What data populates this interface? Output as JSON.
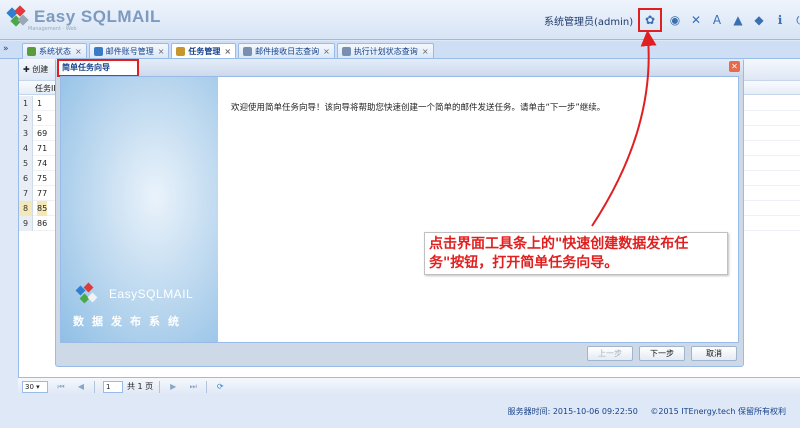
{
  "app": {
    "title": "Easy SQLMAIL",
    "subtitle": "Management · Web",
    "user": "系统管理员(admin)"
  },
  "toolbar": {
    "icons": [
      {
        "name": "quick-create-task-icon",
        "glyph": "✿",
        "highlighted": true
      },
      {
        "name": "globe-icon",
        "glyph": "◉",
        "highlighted": false
      },
      {
        "name": "tools-icon",
        "glyph": "✕",
        "highlighted": false
      },
      {
        "name": "font-icon",
        "glyph": "A",
        "highlighted": false
      },
      {
        "name": "chart-icon",
        "glyph": "▲",
        "highlighted": false
      },
      {
        "name": "box-icon",
        "glyph": "◆",
        "highlighted": false
      },
      {
        "name": "info-icon",
        "glyph": "ℹ",
        "highlighted": false
      },
      {
        "name": "power-icon",
        "glyph": "⏻",
        "highlighted": false
      }
    ]
  },
  "tabs": [
    {
      "label": "系统状态",
      "active": false,
      "color": "#5a9b3c"
    },
    {
      "label": "邮件账号管理",
      "active": false,
      "color": "#3a7bc8"
    },
    {
      "label": "任务管理",
      "active": true,
      "color": "#c8962e"
    },
    {
      "label": "邮件接收日志查询",
      "active": false,
      "color": "#7a8fb0"
    },
    {
      "label": "执行计划状态查询",
      "active": false,
      "color": "#7a8fb0"
    }
  ],
  "grid": {
    "create_label": "创建",
    "column_header": "任务ID",
    "rows": [
      {
        "n": "1",
        "v": "1",
        "selected": false
      },
      {
        "n": "2",
        "v": "5",
        "selected": false
      },
      {
        "n": "3",
        "v": "69",
        "selected": false
      },
      {
        "n": "4",
        "v": "71",
        "selected": false
      },
      {
        "n": "5",
        "v": "74",
        "selected": false
      },
      {
        "n": "6",
        "v": "75",
        "selected": false
      },
      {
        "n": "7",
        "v": "77",
        "selected": false
      },
      {
        "n": "8",
        "v": "85",
        "selected": true
      },
      {
        "n": "9",
        "v": "86",
        "selected": false
      }
    ]
  },
  "pager": {
    "page_size": "30",
    "page": "1",
    "total": "共 1 页"
  },
  "footer": {
    "server_time": "服务器时间: 2015-10-06 09:22:50",
    "copyright": "©2015 ITEnergy.tech 保留所有权利"
  },
  "wizard": {
    "title": "简单任务向导",
    "brand": "EasySQLMAIL",
    "tagline": "数据发布系统",
    "welcome": "欢迎使用简单任务向导！该向导将帮助您快速创建一个简单的邮件发送任务。请单击“下一步”继续。",
    "prev": "上一步",
    "next": "下一步",
    "cancel": "取消"
  },
  "annotation": {
    "text": "点击界面工具条上的\"快速创建数据发布任务\"按钮，打开简单任务向导。",
    "color": "#e02020"
  }
}
